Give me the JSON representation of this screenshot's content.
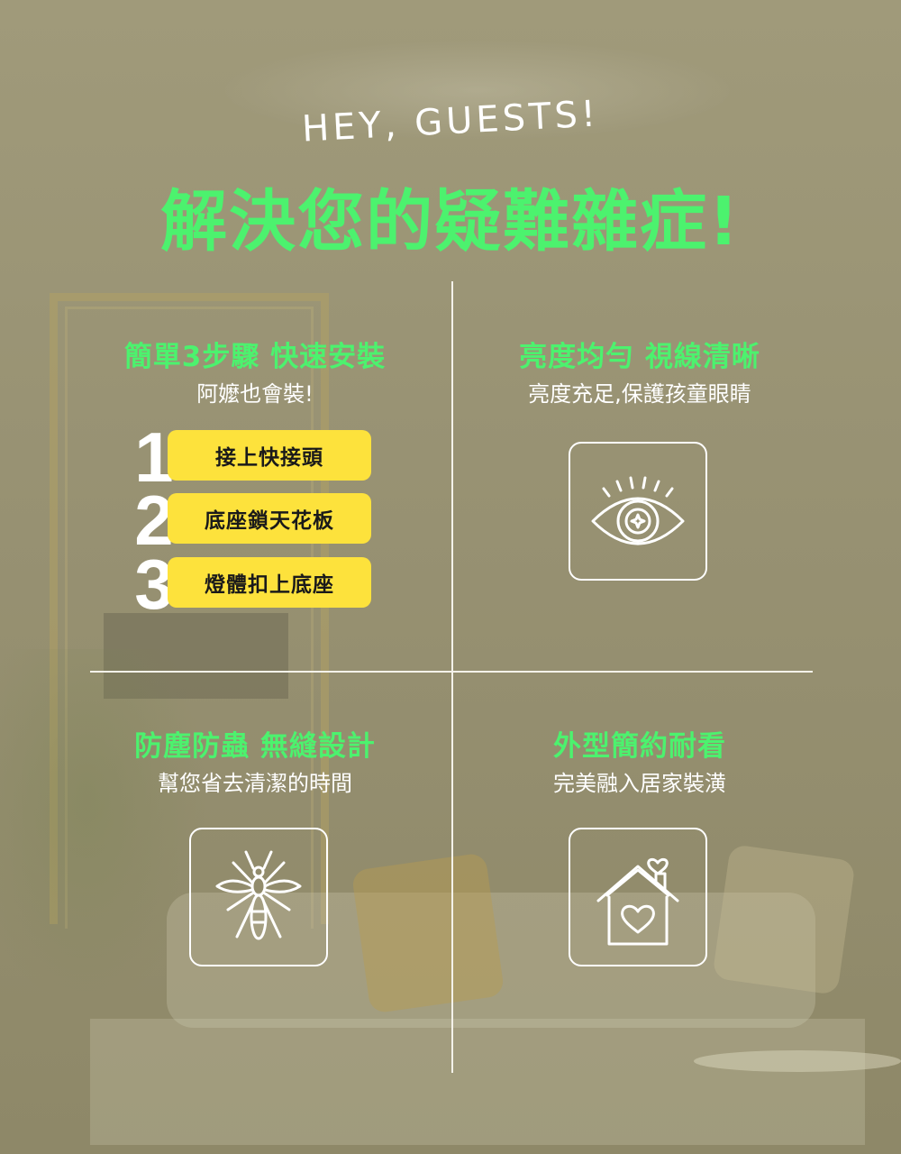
{
  "header": {
    "greeting": "HEY, GUESTS!",
    "title": "解決您的疑難雜症!"
  },
  "features": [
    {
      "title": "簡單3步驟 快速安裝",
      "subtitle": "阿嬤也會裝!",
      "steps": [
        {
          "number": "1",
          "label": "接上快接頭"
        },
        {
          "number": "2",
          "label": "底座鎖天花板"
        },
        {
          "number": "3",
          "label": "燈體扣上底座"
        }
      ]
    },
    {
      "title": "亮度均勻 視線清晰",
      "subtitle": "亮度充足,保護孩童眼睛",
      "icon": "eye-icon"
    },
    {
      "title": "防塵防蟲 無縫設計",
      "subtitle": "幫您省去清潔的時間",
      "icon": "mosquito-icon"
    },
    {
      "title": "外型簡約耐看",
      "subtitle": "完美融入居家裝潢",
      "icon": "house-heart-icon"
    }
  ],
  "colors": {
    "accent_green": "#4cf26e",
    "step_yellow": "#fde23c",
    "text_white": "#ffffff"
  }
}
